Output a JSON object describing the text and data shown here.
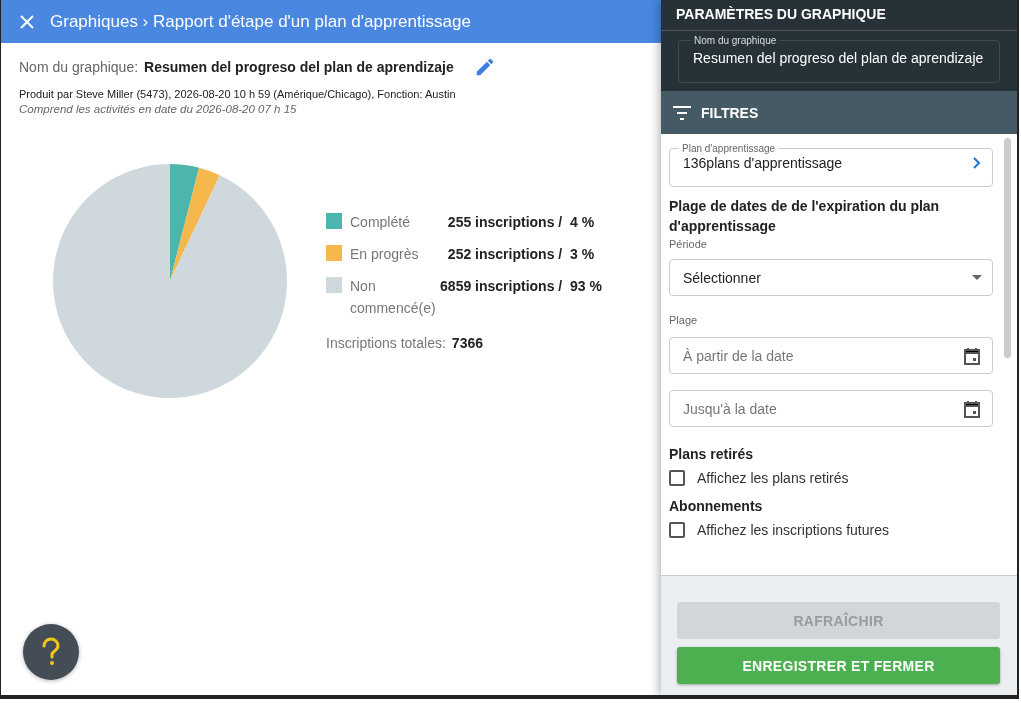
{
  "header": {
    "breadcrumb": "Graphiques › Rapport d'étape d'un plan d'apprentissage"
  },
  "report": {
    "name_label": "Nom du graphique:",
    "name": "Resumen del progreso del plan de aprendizaje",
    "produced": "Produit par Steve Miller (5473), 2026-08-20 10 h 59 (Amérique/Chicago), Fonction: Austin",
    "includes": "Comprend les activités en date du 2026-08-20 07 h 15"
  },
  "chart_data": {
    "type": "pie",
    "categories": [
      "Complété",
      "En progrès",
      "Non commencé(e)"
    ],
    "values": [
      4,
      3,
      93
    ],
    "legend": "right"
  },
  "legend": [
    {
      "color": "#4db6ac",
      "count": "255 inscriptions /",
      "percent": "4 %"
    },
    {
      "color": "#f5b84d",
      "count": "252 inscriptions /",
      "percent": "3 %"
    },
    {
      "color": "#cfd8dc",
      "count": "6859 inscriptions /",
      "percent": "93 %"
    }
  ],
  "total": {
    "label": "Inscriptions totales:",
    "value": "7366"
  },
  "settings": {
    "title": "PARAMÈTRES DU GRAPHIQUE",
    "name_field": {
      "label": "Nom du graphique",
      "value": "Resumen del progreso del plan de aprendizaje"
    },
    "filters_title": "FILTRES",
    "plan_field": {
      "label": "Plan d'apprentissage",
      "value": "136plans d'apprentissage"
    },
    "date_heading": "Plage de dates de de l'expiration du plan d'apprentissage",
    "period_label": "Période",
    "period_value": "Sélectionner",
    "range_label": "Plage",
    "from_placeholder": "À partir de la date",
    "to_placeholder": "Jusqu'à la date",
    "checks": [
      {
        "heading": "Plans retirés",
        "label": "Affichez les plans retirés",
        "checked": false
      },
      {
        "heading": "Abonnements",
        "label": "Affichez les inscriptions futures",
        "checked": false
      }
    ],
    "buttons": [
      {
        "label": "RAFRAÎCHIR",
        "disabled": true
      },
      {
        "label": "ENREGISTRER ET FERMER",
        "disabled": false
      }
    ]
  }
}
